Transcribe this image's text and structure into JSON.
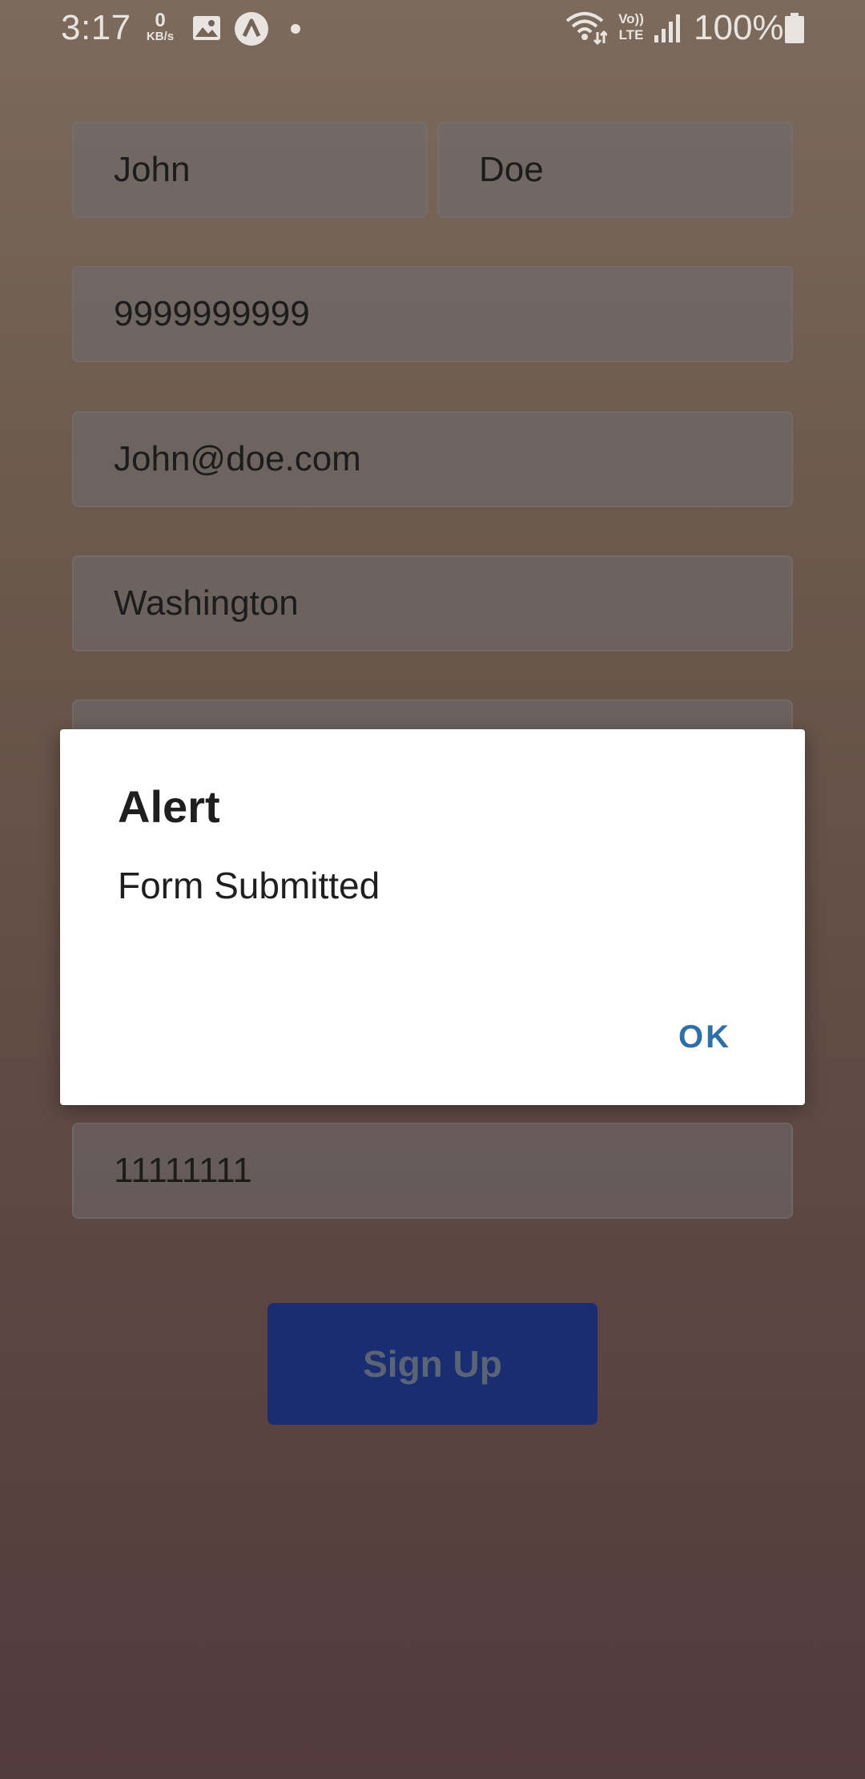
{
  "status_bar": {
    "time": "3:17",
    "speed_value": "0",
    "speed_unit": "KB/s",
    "volte_top": "Vo))",
    "volte_bottom": "LTE",
    "battery_percent": "100%",
    "icons": [
      "gallery-icon",
      "app-icon",
      "dot-icon",
      "wifi-icon",
      "signal-icon",
      "battery-icon"
    ]
  },
  "form": {
    "first_name": "John",
    "last_name": "Doe",
    "phone": "9999999999",
    "email": "John@doe.com",
    "city": "Washington",
    "hidden_field": "",
    "code": "11111111",
    "submit_label": "Sign Up"
  },
  "dialog": {
    "title": "Alert",
    "message": "Form Submitted",
    "ok_label": "OK"
  },
  "colors": {
    "button_bg": "#1a2d73",
    "ok_text": "#2f6fa6"
  }
}
